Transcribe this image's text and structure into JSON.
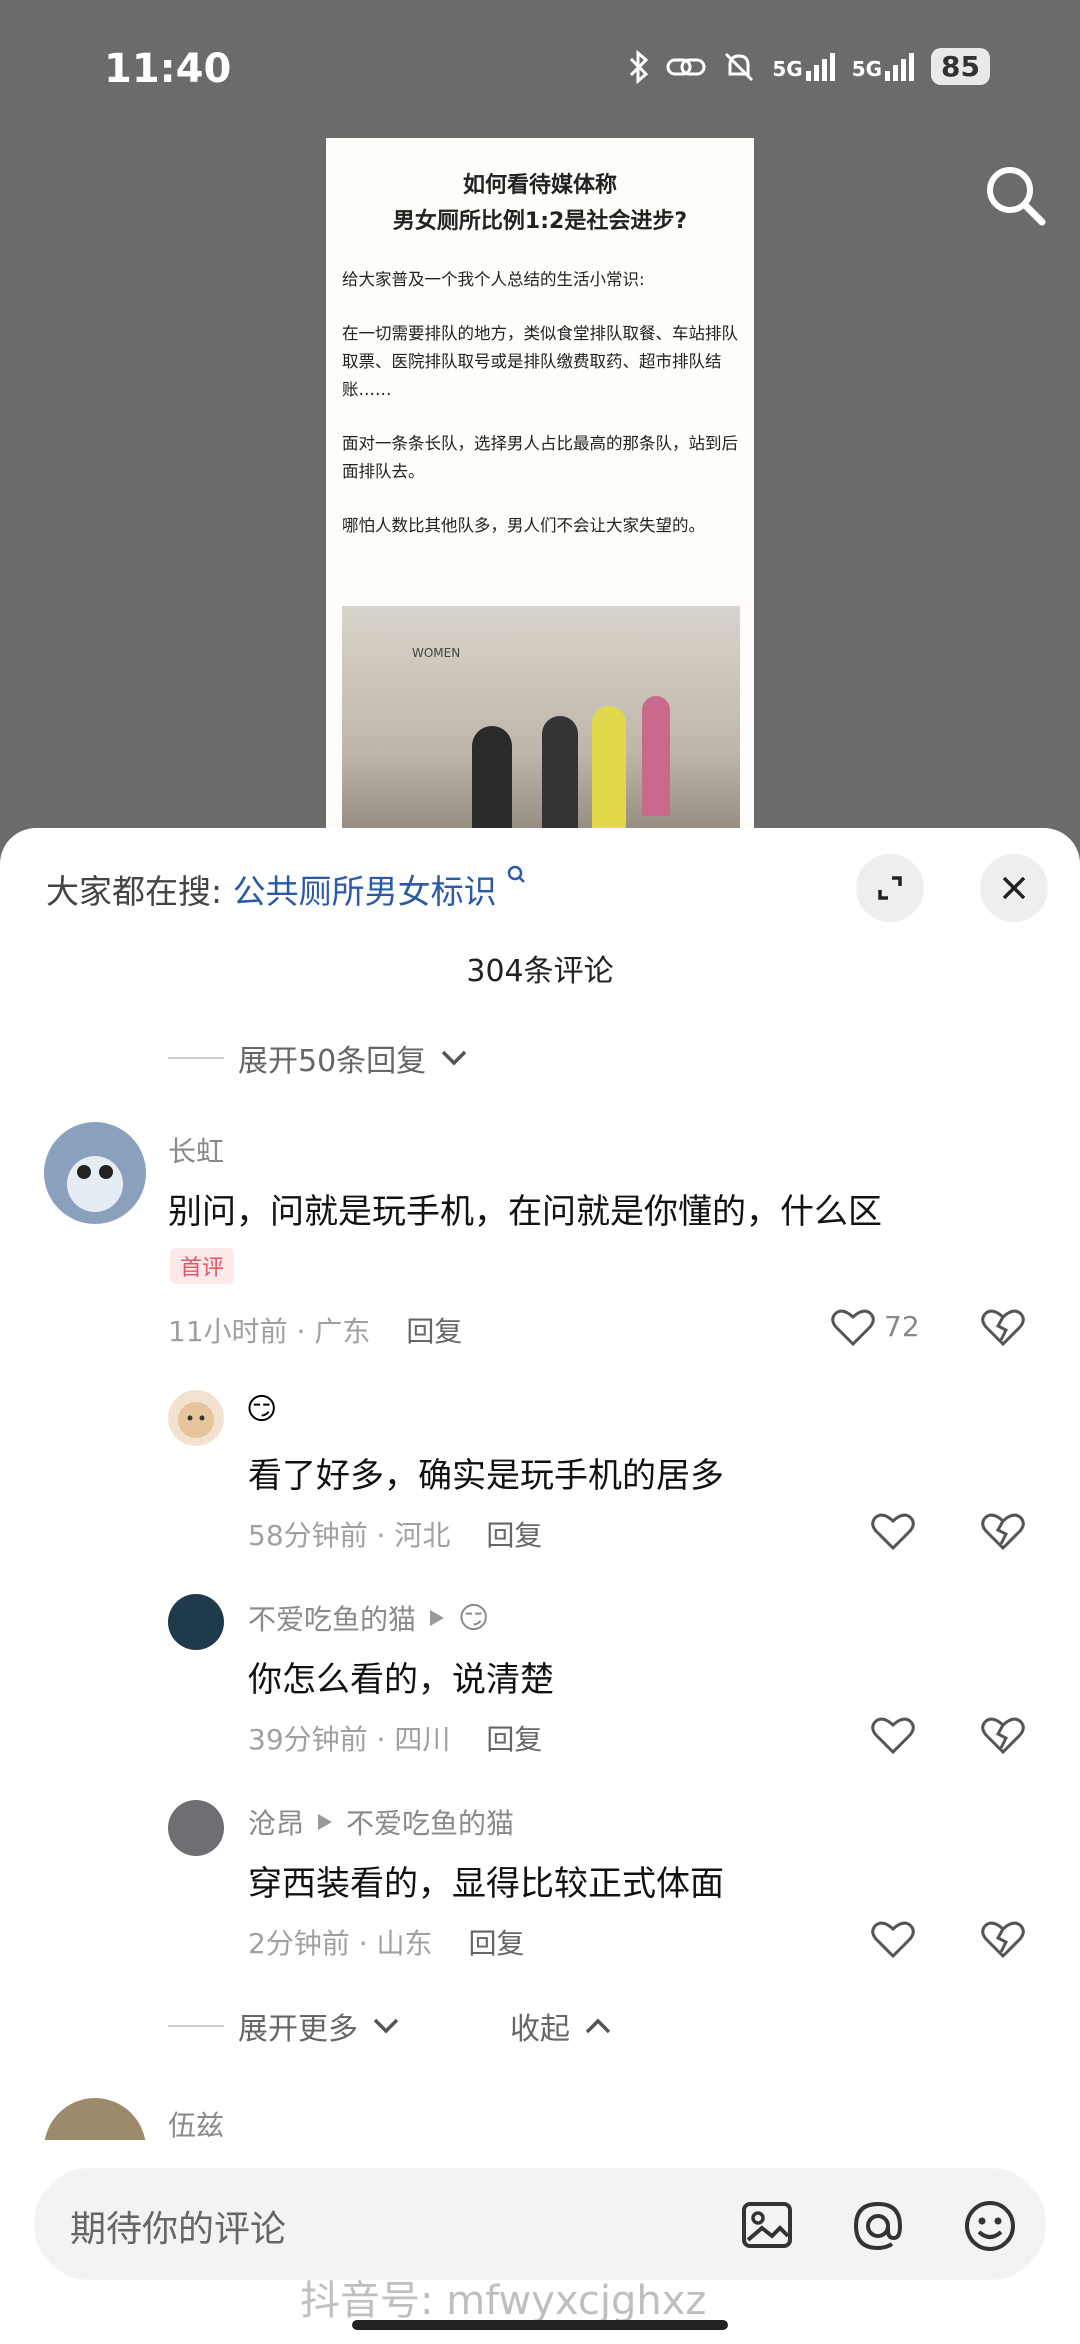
{
  "status": {
    "time": "11:40",
    "battery": "85",
    "signal1": "5G",
    "signal2": "5G"
  },
  "video": {
    "title_line1": "如何看待媒体称",
    "title_line2": "男女厕所比例1:2是社会进步?",
    "para1": "给大家普及一个我个人总结的生活小常识:",
    "para2": "在一切需要排队的地方，类似食堂排队取餐、车站排队取票、医院排队取号或是排队缴费取药、超市排队结账……",
    "para3": "面对一条条长队，选择男人占比最高的那条队，站到后面排队去。",
    "para4": "哪怕人数比其他队多，男人们不会让大家失望的。",
    "photo_sign": "WOMEN"
  },
  "sheet": {
    "hot_search_label": "大家都在搜:",
    "hot_search_keyword": "公共厕所男女标识",
    "comment_count": "304条评论",
    "expand_top": "展开50条回复",
    "expand_more": "展开更多",
    "collapse": "收起"
  },
  "comments": [
    {
      "name": "长虹",
      "text": "别问，问就是玩手机，在问就是你懂的，什么区",
      "badge": "首评",
      "time": "11小时前",
      "location": "广东",
      "reply": "回复",
      "likes": "72"
    },
    {
      "name": "",
      "emoji": "😏",
      "text": "看了好多，确实是玩手机的居多",
      "time": "58分钟前",
      "location": "河北",
      "reply": "回复"
    },
    {
      "name": "不爱吃鱼的猫",
      "emoji": "😏",
      "text": "你怎么看的，说清楚",
      "time": "39分钟前",
      "location": "四川",
      "reply": "回复"
    },
    {
      "name": "沧昂",
      "reply_to": "不爱吃鱼的猫",
      "text": "穿西装看的，显得比较正式体面",
      "time": "2分钟前",
      "location": "山东",
      "reply": "回复"
    },
    {
      "name": "伍兹"
    }
  ],
  "input": {
    "placeholder": "期待你的评论"
  },
  "watermark": "抖音号: mfwyxcjghxz",
  "colors": {
    "link": "#2b5aa8",
    "badge": "#e0566a"
  }
}
